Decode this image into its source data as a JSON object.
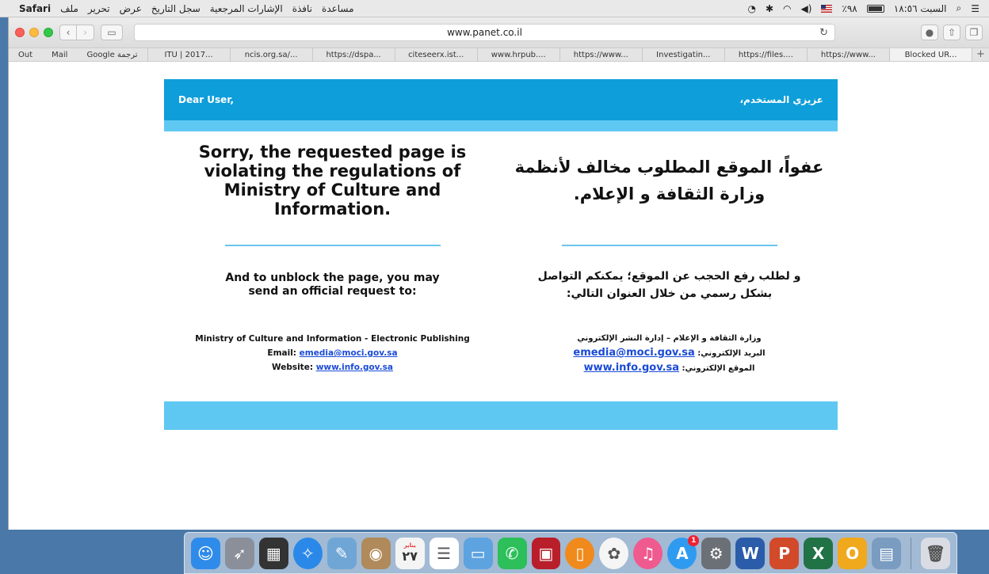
{
  "menubar": {
    "app": "Safari",
    "items": [
      "ملف",
      "تحرير",
      "عرض",
      "سجل التاريخ",
      "الإشارات المرجعية",
      "نافذة",
      "مساعدة"
    ],
    "clock": "السبت ١٨:٥٦",
    "battery": "٪٩٨"
  },
  "browser": {
    "url": "www.panet.co.il",
    "favorites": [
      "Out",
      "Mail",
      "Google ترجمة"
    ],
    "tabs": [
      "ITU | 2017...",
      "ncis.org.sa/...",
      "https://dspa...",
      "citeseerx.ist...",
      "www.hrpub....",
      "https://www...",
      "Investigatin...",
      "https://files....",
      "https://www...",
      "Blocked UR..."
    ],
    "active_tab_index": 9
  },
  "page": {
    "greeting_en": "Dear User,",
    "greeting_ar": "عزيزي المستخدم،",
    "title_en": "Sorry, the requested page is violating the regulations of Ministry of Culture and Information.",
    "title_ar": "عفواً، الموقع المطلوب مخالف لأنظمة وزارة الثقافة و الإعلام.",
    "sub_en": "And to unblock the page, you may send an official request to:",
    "sub_ar": "و لطلب رفع الحجب عن الموقع؛ يمكنكم التواصل بشكل رسمي من خلال العنوان التالي:",
    "contact_en": {
      "org": "Ministry of Culture and Information - Electronic Publishing",
      "email_label": "Email:",
      "email": "emedia@moci.gov.sa",
      "website_label": "Website:",
      "website": "www.info.gov.sa"
    },
    "contact_ar": {
      "org": "وزارة الثقافة و الإعلام – إدارة النشر الإلكتروني",
      "email_label": "البريد الإلكتروني:",
      "email": "emedia@moci.gov.sa",
      "website_label": "الموقع الإلكتروني:",
      "website": "www.info.gov.sa"
    }
  },
  "dock": {
    "calendar_month": "يناير",
    "calendar_day": "٢٧",
    "appstore_badge": "1",
    "apps": [
      {
        "name": "finder-icon",
        "color": "#2f8bea",
        "glyph": "☺"
      },
      {
        "name": "launchpad-icon",
        "color": "#8a8f99",
        "glyph": "➶"
      },
      {
        "name": "dashboard-icon",
        "color": "#333333",
        "glyph": "▦"
      },
      {
        "name": "safari-icon",
        "color": "#2a89e8",
        "glyph": "✧"
      },
      {
        "name": "preview-icon",
        "color": "#6fa6d6",
        "glyph": "✎"
      },
      {
        "name": "contacts-icon",
        "color": "#b08a5a",
        "glyph": "◉"
      },
      {
        "name": "calendar-icon",
        "color": "#f4f4f4",
        "glyph": ""
      },
      {
        "name": "reminders-icon",
        "color": "#ffffff",
        "glyph": "☰"
      },
      {
        "name": "keynote-icon",
        "color": "#5da3e0",
        "glyph": "▭"
      },
      {
        "name": "facetime-icon",
        "color": "#2cbf5a",
        "glyph": "✆"
      },
      {
        "name": "photo-booth-icon",
        "color": "#b81f2a",
        "glyph": "▣"
      },
      {
        "name": "ibooks-icon",
        "color": "#f08a1c",
        "glyph": "▯"
      },
      {
        "name": "photos-icon",
        "color": "#f5f5f5",
        "glyph": "✿"
      },
      {
        "name": "itunes-icon",
        "color": "#ef5a8f",
        "glyph": "♫"
      },
      {
        "name": "app-store-icon",
        "color": "#2f9bf0",
        "glyph": "A"
      },
      {
        "name": "system-preferences-icon",
        "color": "#6b6f76",
        "glyph": "⚙"
      },
      {
        "name": "word-icon",
        "color": "#2a5caa",
        "glyph": "W"
      },
      {
        "name": "powerpoint-icon",
        "color": "#d24a2a",
        "glyph": "P"
      },
      {
        "name": "excel-icon",
        "color": "#217346",
        "glyph": "X"
      },
      {
        "name": "outlook-icon",
        "color": "#f0a81c",
        "glyph": "O"
      },
      {
        "name": "image-capture-icon",
        "color": "#7a9cc0",
        "glyph": "▤"
      },
      {
        "name": "trash-icon",
        "color": "#d9dde3",
        "glyph": "🗑"
      }
    ]
  }
}
